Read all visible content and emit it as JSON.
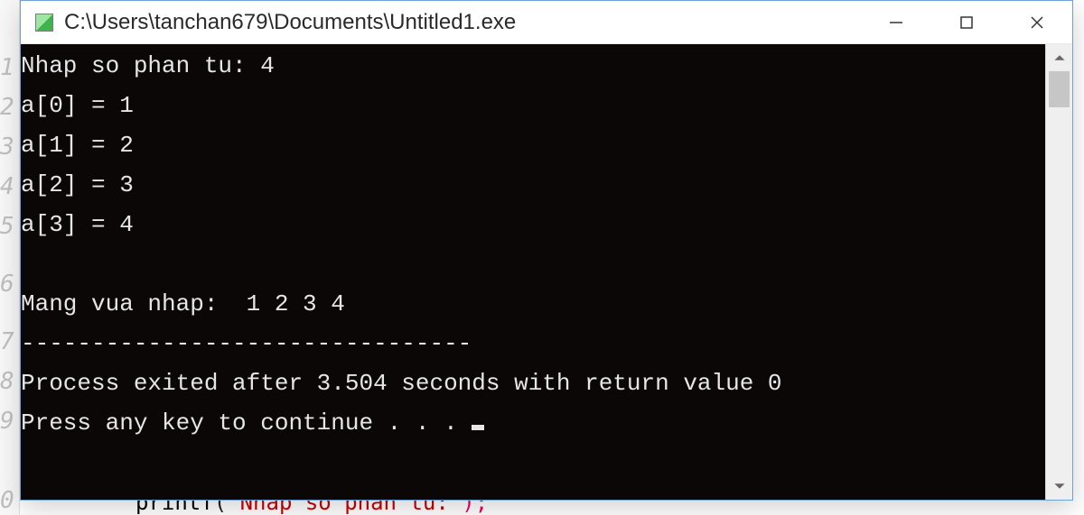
{
  "gutter": {
    "lines": [
      "1",
      "2",
      "3",
      "4",
      "5",
      "6",
      "7",
      "8",
      "9",
      "0"
    ]
  },
  "background_code": {
    "fn": "printf",
    "open": "(",
    "str": "\"Nhap so phan tu:\"",
    "close": ");"
  },
  "window": {
    "title": "C:\\Users\\tanchan679\\Documents\\Untitled1.exe"
  },
  "console": {
    "lines": [
      "Nhap so phan tu: 4",
      "a[0] = 1",
      "a[1] = 2",
      "a[2] = 3",
      "a[3] = 4",
      "",
      "Mang vua nhap:  1 2 3 4",
      "--------------------------------",
      "Process exited after 3.504 seconds with return value 0",
      "Press any key to continue . . . "
    ]
  }
}
